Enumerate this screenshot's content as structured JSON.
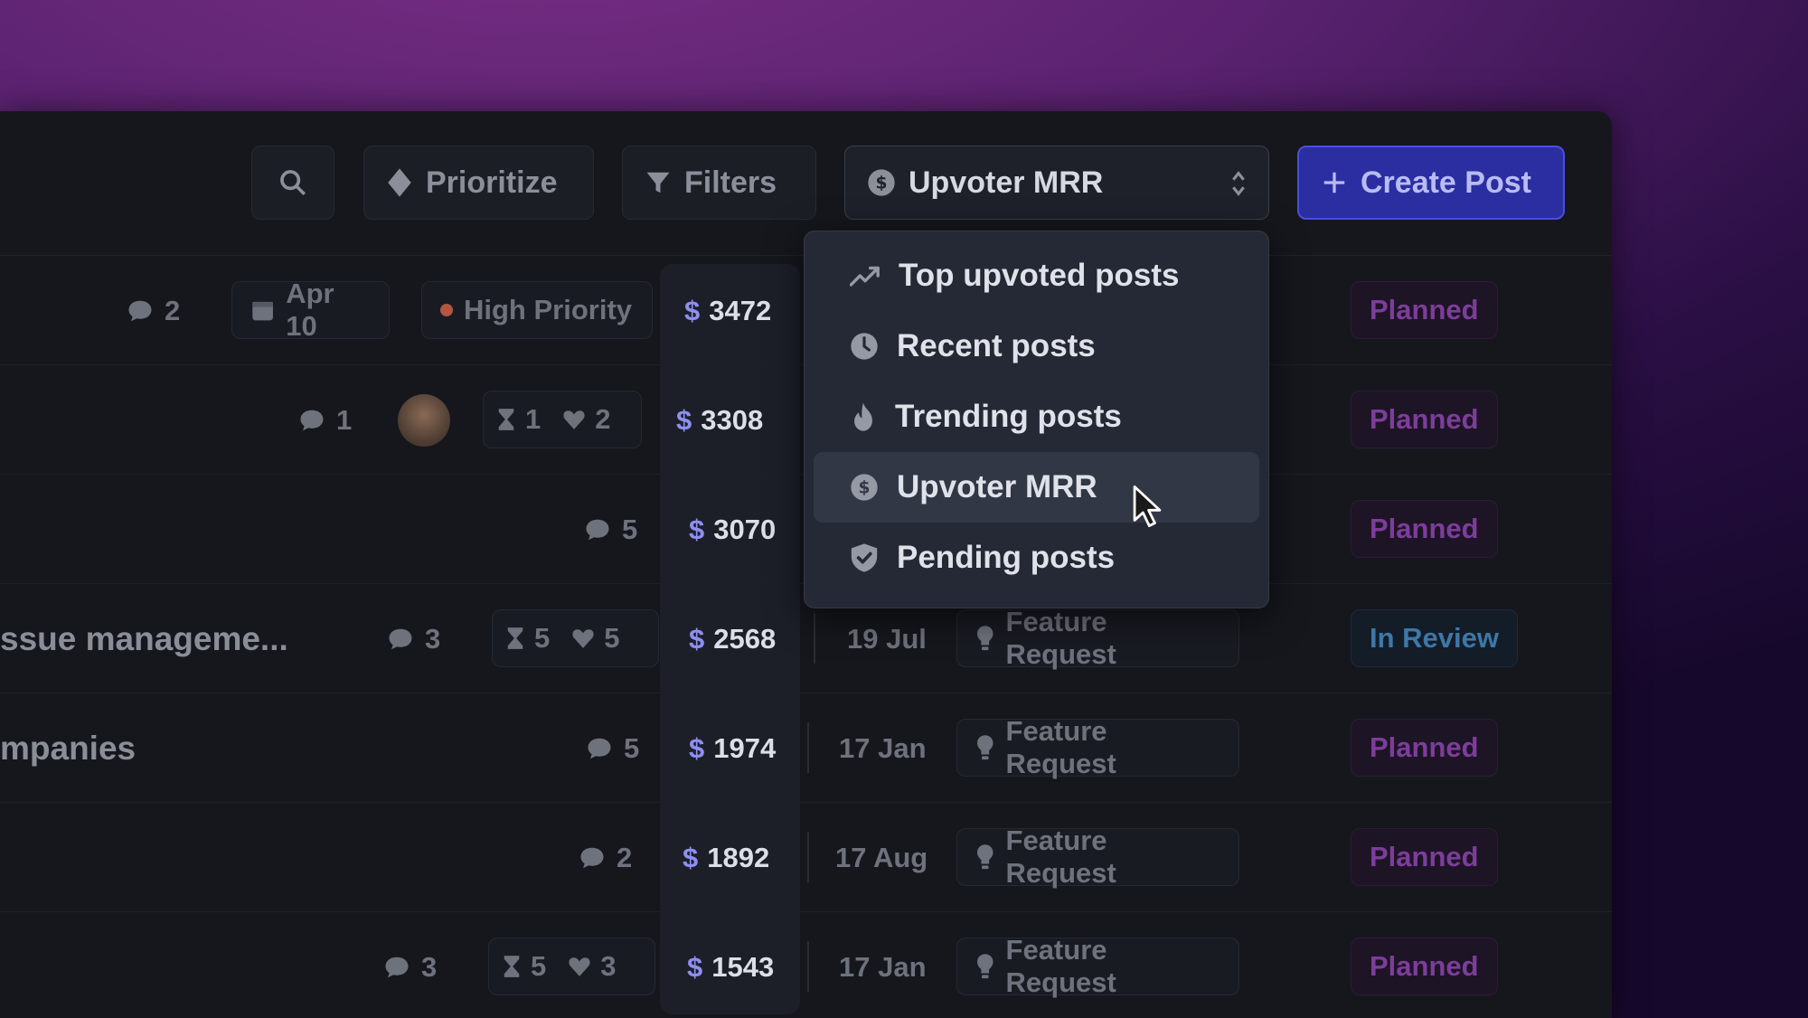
{
  "toolbar": {
    "prioritize_label": "Prioritize",
    "filters_label": "Filters",
    "sort_label": "Upvoter MRR",
    "create_label": "Create Post"
  },
  "sort_menu": {
    "items": [
      {
        "label": "Top upvoted posts",
        "icon": "trending-up-icon"
      },
      {
        "label": "Recent posts",
        "icon": "clock-icon"
      },
      {
        "label": "Trending posts",
        "icon": "flame-icon"
      },
      {
        "label": "Upvoter MRR",
        "icon": "dollar-circle-icon",
        "selected": true
      },
      {
        "label": "Pending posts",
        "icon": "shield-check-icon"
      }
    ]
  },
  "rows": [
    {
      "title": "",
      "comments": "2",
      "date_chip": "Apr 10",
      "priority": "High Priority",
      "mrr": "3472",
      "status": "Planned"
    },
    {
      "title": "",
      "comments": "1",
      "votes_a": "1",
      "votes_b": "2",
      "mrr": "3308",
      "status": "Planned"
    },
    {
      "title": "",
      "comments": "5",
      "mrr": "3070",
      "status": "Planned"
    },
    {
      "title": "ssue manageme...",
      "comments": "3",
      "votes_a": "5",
      "votes_b": "5",
      "mrr": "2568",
      "date": "19 Jul",
      "tag": "Feature Request",
      "status": "In Review"
    },
    {
      "title": "mpanies",
      "comments": "5",
      "mrr": "1974",
      "date": "17 Jan",
      "tag": "Feature Request",
      "status": "Planned"
    },
    {
      "title": "",
      "comments": "2",
      "mrr": "1892",
      "date": "17 Aug",
      "tag": "Feature Request",
      "status": "Planned"
    },
    {
      "title": "",
      "comments": "3",
      "votes_a": "5",
      "votes_b": "3",
      "mrr": "1543",
      "date": "17 Jan",
      "tag": "Feature Request",
      "status": "Planned"
    }
  ],
  "currency_symbol": "$",
  "colors": {
    "accent": "#4b4ee0",
    "planned": "#7d3d9b",
    "in_review": "#3c78a8",
    "mrr_dollar": "#8e8ff0"
  }
}
